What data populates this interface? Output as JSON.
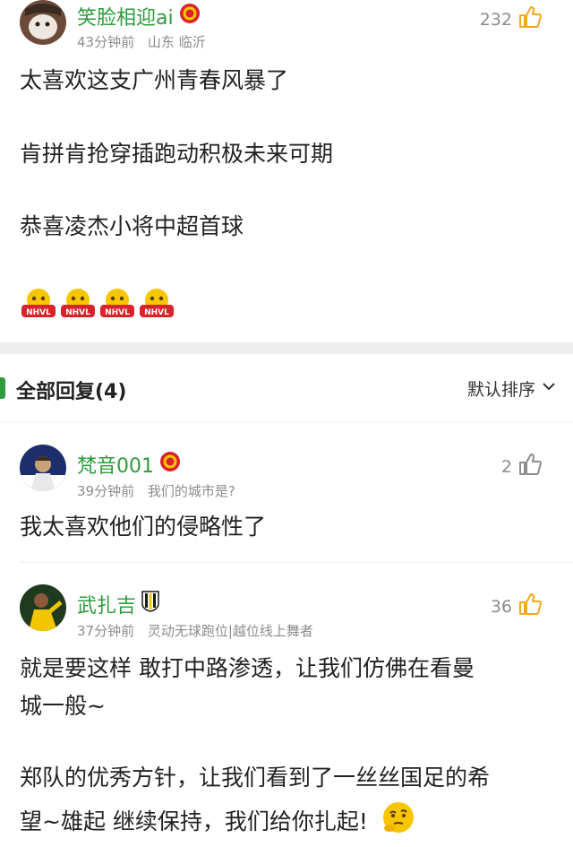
{
  "main_comment": {
    "username": "笑脸相迎ai",
    "time": "43分钟前",
    "location": "山东 临沂",
    "likes": "232",
    "lines": [
      "太喜欢这支广州青春风暴了",
      "肯拼肯抢穿插跑动积极未来可期",
      "恭喜凌杰小将中超首球"
    ],
    "emoji_text": "NHVL"
  },
  "replies_header": {
    "title": "全部回复(4)",
    "sort_label": "默认排序"
  },
  "replies": [
    {
      "username": "梵音001",
      "time": "39分钟前",
      "extra": "我们的城市是?",
      "likes": "2",
      "text": "我太喜欢他们的侵略性了"
    },
    {
      "username": "武扎吉",
      "time": "37分钟前",
      "extra": "灵动无球跑位|越位线上舞者",
      "likes": "36",
      "lines": [
        "就是要这样 敢打中路渗透，让我们仿佛在看曼",
        "城一般~",
        "郑队的优秀方针，让我们看到了一丝丝国足的希",
        "望~雄起 继续保持，我们给你扎起!"
      ]
    }
  ],
  "colors": {
    "accent": "#2e9b3c",
    "like_orange": "#f5a623",
    "meta": "#8c8c8c"
  }
}
